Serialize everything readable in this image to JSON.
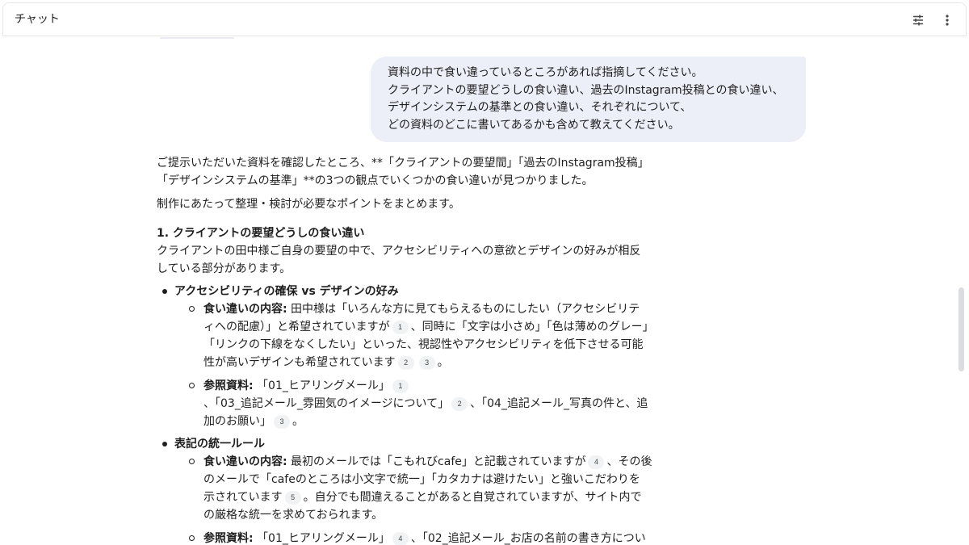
{
  "header": {
    "title": "チャット"
  },
  "user_message": {
    "lines": [
      "資料の中で食い違っているところがあれば指摘してください。",
      "クライアントの要望どうしの食い違い、過去のInstagram投稿との食い違い、",
      "デザインシステムの基準との食い違い、それぞれについて、",
      "どの資料のどこに書いてあるかも含めて教えてください。"
    ]
  },
  "response": {
    "intro_line1": "ご提示いただいた資料を確認したところ、**「クライアントの要望間」「過去のInstagram投稿」",
    "intro_line2": "「デザインシステムの基準」**の3つの観点でいくつかの食い違いが見つかりました。",
    "intro2": "制作にあたって整理・検討が必要なポイントをまとめます。",
    "section1_heading": "1. クライアントの要望どうしの食い違い",
    "section1_line1": "クライアントの田中様ご自身の要望の中で、アクセシビリティへの意欲とデザインの好みが相反",
    "section1_line2": "している部分があります。",
    "items": [
      {
        "title": "アクセシビリティの確保 vs デザインの好み",
        "diff_label": "食い違いの内容:",
        "diff_l1": " 田中様は「いろんな方に見てもらえるものにしたい（アクセシビリテ",
        "diff_l2a": "ィへの配慮）」と希望されていますが",
        "diff_c1": "1",
        "diff_l2b": "、同時に「文字は小さめ」「色は薄めのグレー」",
        "diff_l3": "「リンクの下線をなくしたい」といった、視認性やアクセシビリティを低下させる可能",
        "diff_l4a": "性が高いデザインも希望されています",
        "diff_c2": "2",
        "diff_c3": "3",
        "diff_l4b": "。",
        "ref_label": "参照資料:",
        "ref_l1": " 「01_ヒアリングメール」",
        "ref_c1": "1",
        "ref_l2a": "、「03_追記メール_雰囲気のイメージについて」",
        "ref_c2": "2",
        "ref_l2b": "、「04_追記メール_写真の件と、追",
        "ref_l3a": "加のお願い」",
        "ref_c3": "3",
        "ref_l3b": "。"
      },
      {
        "title": "表記の統一ルール",
        "diff_label": "食い違いの内容:",
        "diff_l1a": " 最初のメールでは「こもれびcafe」と記載されていますが",
        "diff_c1": "4",
        "diff_l1b": "、その後",
        "diff_l2": "のメールで「cafeのところは小文字で統一」「カタカナは避けたい」と強いこだわりを",
        "diff_l3a": "示されています",
        "diff_c2": "5",
        "diff_l3b": "。自分でも間違えることがあると自覚されていますが、サイト内で",
        "diff_l4": "の厳格な統一を求めておられます。",
        "ref_label": "参照資料:",
        "ref_l1a": " 「01_ヒアリングメール」",
        "ref_c1": "4",
        "ref_l1b": "、「02_追記メール_お店の名前の書き方につい"
      }
    ]
  },
  "icons": {
    "tune": "tune-icon",
    "more": "more-vert-icon"
  },
  "colors": {
    "bubble": "#eceef8",
    "text": "#1f1f1f",
    "citation_bg": "#f1f2f4"
  }
}
